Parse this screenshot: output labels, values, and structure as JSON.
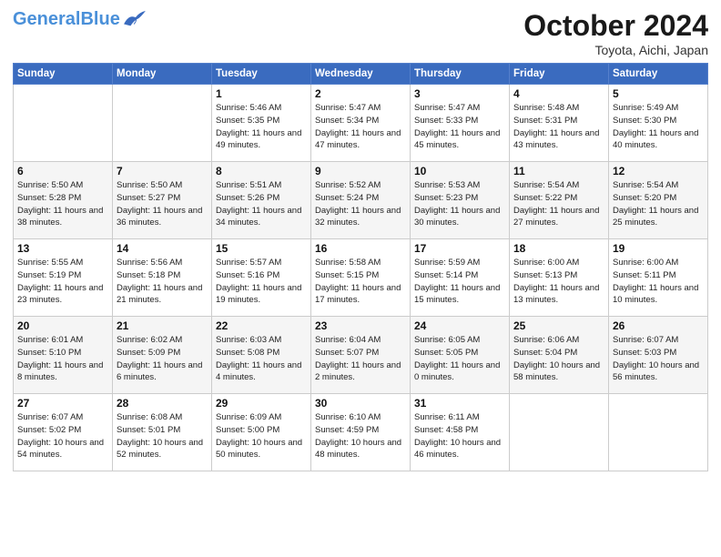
{
  "header": {
    "logo_general": "General",
    "logo_blue": "Blue",
    "month_title": "October 2024",
    "location": "Toyota, Aichi, Japan"
  },
  "weekdays": [
    "Sunday",
    "Monday",
    "Tuesday",
    "Wednesday",
    "Thursday",
    "Friday",
    "Saturday"
  ],
  "weeks": [
    [
      {
        "day": "",
        "info": ""
      },
      {
        "day": "",
        "info": ""
      },
      {
        "day": "1",
        "info": "Sunrise: 5:46 AM\nSunset: 5:35 PM\nDaylight: 11 hours and 49 minutes."
      },
      {
        "day": "2",
        "info": "Sunrise: 5:47 AM\nSunset: 5:34 PM\nDaylight: 11 hours and 47 minutes."
      },
      {
        "day": "3",
        "info": "Sunrise: 5:47 AM\nSunset: 5:33 PM\nDaylight: 11 hours and 45 minutes."
      },
      {
        "day": "4",
        "info": "Sunrise: 5:48 AM\nSunset: 5:31 PM\nDaylight: 11 hours and 43 minutes."
      },
      {
        "day": "5",
        "info": "Sunrise: 5:49 AM\nSunset: 5:30 PM\nDaylight: 11 hours and 40 minutes."
      }
    ],
    [
      {
        "day": "6",
        "info": "Sunrise: 5:50 AM\nSunset: 5:28 PM\nDaylight: 11 hours and 38 minutes."
      },
      {
        "day": "7",
        "info": "Sunrise: 5:50 AM\nSunset: 5:27 PM\nDaylight: 11 hours and 36 minutes."
      },
      {
        "day": "8",
        "info": "Sunrise: 5:51 AM\nSunset: 5:26 PM\nDaylight: 11 hours and 34 minutes."
      },
      {
        "day": "9",
        "info": "Sunrise: 5:52 AM\nSunset: 5:24 PM\nDaylight: 11 hours and 32 minutes."
      },
      {
        "day": "10",
        "info": "Sunrise: 5:53 AM\nSunset: 5:23 PM\nDaylight: 11 hours and 30 minutes."
      },
      {
        "day": "11",
        "info": "Sunrise: 5:54 AM\nSunset: 5:22 PM\nDaylight: 11 hours and 27 minutes."
      },
      {
        "day": "12",
        "info": "Sunrise: 5:54 AM\nSunset: 5:20 PM\nDaylight: 11 hours and 25 minutes."
      }
    ],
    [
      {
        "day": "13",
        "info": "Sunrise: 5:55 AM\nSunset: 5:19 PM\nDaylight: 11 hours and 23 minutes."
      },
      {
        "day": "14",
        "info": "Sunrise: 5:56 AM\nSunset: 5:18 PM\nDaylight: 11 hours and 21 minutes."
      },
      {
        "day": "15",
        "info": "Sunrise: 5:57 AM\nSunset: 5:16 PM\nDaylight: 11 hours and 19 minutes."
      },
      {
        "day": "16",
        "info": "Sunrise: 5:58 AM\nSunset: 5:15 PM\nDaylight: 11 hours and 17 minutes."
      },
      {
        "day": "17",
        "info": "Sunrise: 5:59 AM\nSunset: 5:14 PM\nDaylight: 11 hours and 15 minutes."
      },
      {
        "day": "18",
        "info": "Sunrise: 6:00 AM\nSunset: 5:13 PM\nDaylight: 11 hours and 13 minutes."
      },
      {
        "day": "19",
        "info": "Sunrise: 6:00 AM\nSunset: 5:11 PM\nDaylight: 11 hours and 10 minutes."
      }
    ],
    [
      {
        "day": "20",
        "info": "Sunrise: 6:01 AM\nSunset: 5:10 PM\nDaylight: 11 hours and 8 minutes."
      },
      {
        "day": "21",
        "info": "Sunrise: 6:02 AM\nSunset: 5:09 PM\nDaylight: 11 hours and 6 minutes."
      },
      {
        "day": "22",
        "info": "Sunrise: 6:03 AM\nSunset: 5:08 PM\nDaylight: 11 hours and 4 minutes."
      },
      {
        "day": "23",
        "info": "Sunrise: 6:04 AM\nSunset: 5:07 PM\nDaylight: 11 hours and 2 minutes."
      },
      {
        "day": "24",
        "info": "Sunrise: 6:05 AM\nSunset: 5:05 PM\nDaylight: 11 hours and 0 minutes."
      },
      {
        "day": "25",
        "info": "Sunrise: 6:06 AM\nSunset: 5:04 PM\nDaylight: 10 hours and 58 minutes."
      },
      {
        "day": "26",
        "info": "Sunrise: 6:07 AM\nSunset: 5:03 PM\nDaylight: 10 hours and 56 minutes."
      }
    ],
    [
      {
        "day": "27",
        "info": "Sunrise: 6:07 AM\nSunset: 5:02 PM\nDaylight: 10 hours and 54 minutes."
      },
      {
        "day": "28",
        "info": "Sunrise: 6:08 AM\nSunset: 5:01 PM\nDaylight: 10 hours and 52 minutes."
      },
      {
        "day": "29",
        "info": "Sunrise: 6:09 AM\nSunset: 5:00 PM\nDaylight: 10 hours and 50 minutes."
      },
      {
        "day": "30",
        "info": "Sunrise: 6:10 AM\nSunset: 4:59 PM\nDaylight: 10 hours and 48 minutes."
      },
      {
        "day": "31",
        "info": "Sunrise: 6:11 AM\nSunset: 4:58 PM\nDaylight: 10 hours and 46 minutes."
      },
      {
        "day": "",
        "info": ""
      },
      {
        "day": "",
        "info": ""
      }
    ]
  ]
}
